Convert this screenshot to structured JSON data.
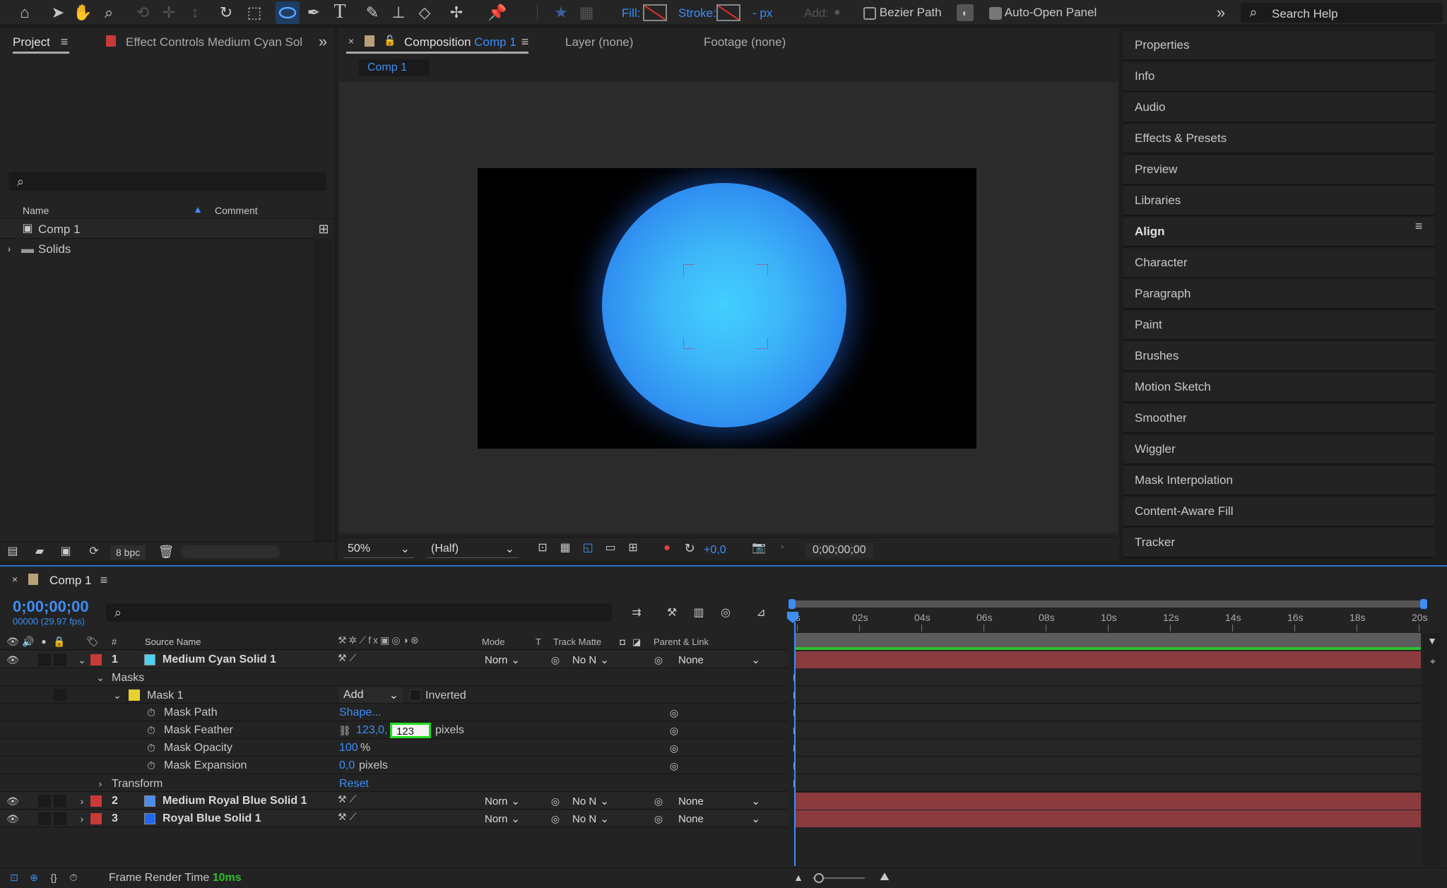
{
  "toolbar": {
    "fill_label": "Fill:",
    "stroke_label": "Stroke:",
    "stroke_px": "- px",
    "add_label": "Add:",
    "bezier_label": "Bezier Path",
    "auto_open_label": "Auto-Open Panel",
    "search_placeholder": "Search Help"
  },
  "project": {
    "tab_project": "Project",
    "tab_effect": "Effect Controls Medium Cyan Sol",
    "col_name": "Name",
    "col_comment": "Comment",
    "items": [
      {
        "label": "Comp 1"
      },
      {
        "label": "Solids"
      }
    ],
    "bpc": "8 bpc"
  },
  "comp": {
    "tab_composition": "Composition",
    "tab_comp_name": "Comp 1",
    "tab_layer": "Layer (none)",
    "tab_footage": "Footage (none)",
    "breadcrumb": "Comp 1",
    "zoom": "50%",
    "resolution": "(Half)",
    "exposure": "+0,0",
    "timecode": "0;00;00;00"
  },
  "right_panel": {
    "items": [
      "Properties",
      "Info",
      "Audio",
      "Effects & Presets",
      "Preview",
      "Libraries",
      "Align",
      "Character",
      "Paragraph",
      "Paint",
      "Brushes",
      "Motion Sketch",
      "Smoother",
      "Wiggler",
      "Mask Interpolation",
      "Content-Aware Fill",
      "Tracker"
    ]
  },
  "timeline": {
    "tab": "Comp 1",
    "timecode": "0;00;00;00",
    "frames": "00000 (29.97 fps)",
    "col_hash": "#",
    "col_source": "Source Name",
    "col_mode": "Mode",
    "col_t": "T",
    "col_track": "Track Matte",
    "col_parent": "Parent & Link",
    "ruler": [
      "0s",
      "02s",
      "04s",
      "06s",
      "08s",
      "10s",
      "12s",
      "14s",
      "16s",
      "18s",
      "20s"
    ],
    "layers": [
      {
        "num": "1",
        "name": "Medium Cyan Solid 1",
        "color": "#4fd0f0",
        "mode": "Norn",
        "matte": "No N",
        "parent": "None"
      },
      {
        "num": "2",
        "name": "Medium Royal Blue Solid 1",
        "color": "#4a8ef0",
        "mode": "Norn",
        "matte": "No N",
        "parent": "None"
      },
      {
        "num": "3",
        "name": "Royal Blue Solid 1",
        "color": "#2066f0",
        "mode": "Norn",
        "matte": "No N",
        "parent": "None"
      }
    ],
    "masks_label": "Masks",
    "mask1": "Mask 1",
    "mask_mode": "Add",
    "inverted": "Inverted",
    "props": [
      {
        "label": "Mask Path",
        "value": "Shape..."
      },
      {
        "label": "Mask Feather",
        "value": "123,0,",
        "input": "123",
        "unit": "pixels"
      },
      {
        "label": "Mask Opacity",
        "value": "100",
        "unit": "%"
      },
      {
        "label": "Mask Expansion",
        "value": "0,0",
        "unit": " pixels"
      }
    ],
    "transform_label": "Transform",
    "reset": "Reset",
    "frame_render_label": "Frame Render Time",
    "frame_render_value": "10ms"
  },
  "colors": {
    "accent": "#3d8df5",
    "layer_bar": "#8b3a3e",
    "label_red": "#c83a3a",
    "green_box": "#22dd22"
  }
}
